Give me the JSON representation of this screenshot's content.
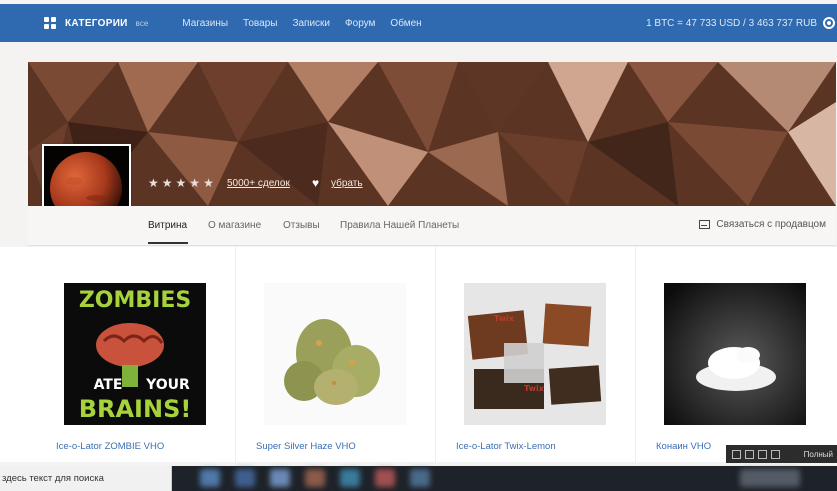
{
  "topbar": {
    "categories_label": "КАТЕГОРИИ",
    "categories_all": "все",
    "nav": [
      "Магазины",
      "Товары",
      "Записки",
      "Форум",
      "Обмен"
    ],
    "rate": "1 BTC = 47 733 USD / 3 463 737 RUB"
  },
  "shop": {
    "stars": [
      "★",
      "★",
      "★",
      "★",
      "★"
    ],
    "deals": "5000+ сделок",
    "heart": "♥",
    "remove": "убрать"
  },
  "tabs": {
    "items": [
      "Витрина",
      "О магазине",
      "Отзывы",
      "Правила Нашей Планеты"
    ],
    "contact": "Связаться с продавцом"
  },
  "products": [
    {
      "title": "Ice-o-Lator ZOMBIE VHO",
      "img_text_1": "ZOMBIES",
      "img_text_2": "ATE",
      "img_text_3": "YOUR",
      "img_text_4": "BRAINS!"
    },
    {
      "title": "Super Silver Haze VHO"
    },
    {
      "title": "Ice-o-Lator Twix-Lemon",
      "img_text_1": "Twix",
      "img_text_2": "Twix"
    },
    {
      "title": "Конаин VHO"
    }
  ],
  "overlay": {
    "full_label": "Полный"
  },
  "taskbar": {
    "search": "здесь текст для поиска"
  },
  "colors": {
    "topbar": "#2f69b0",
    "link": "#3a6fb5",
    "banner": "#5a3322"
  }
}
